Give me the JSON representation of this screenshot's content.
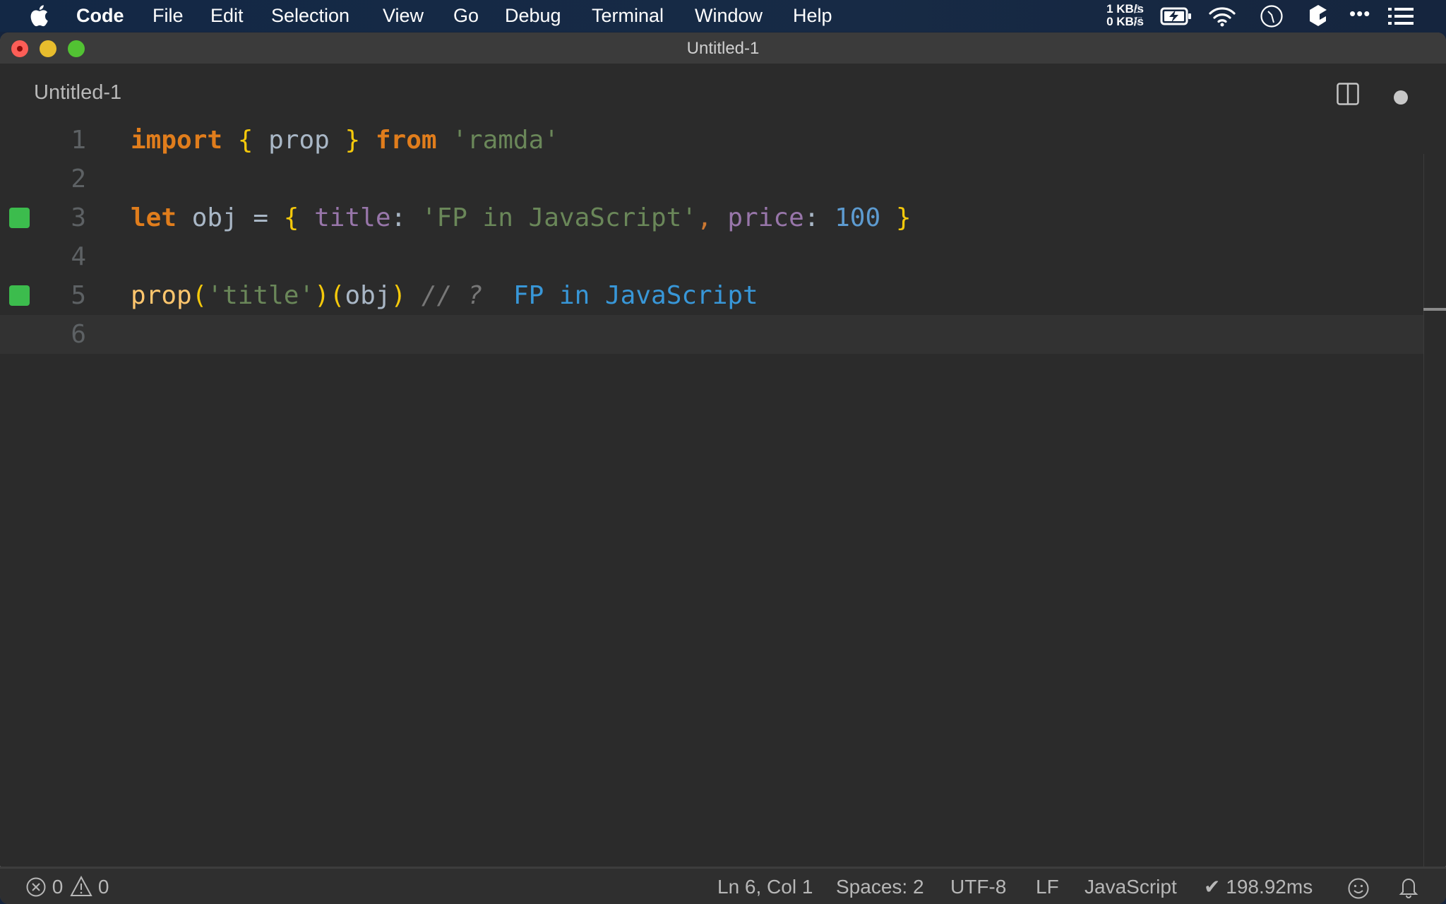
{
  "menubar": {
    "app_name": "Code",
    "menus": [
      "File",
      "Edit",
      "Selection",
      "View",
      "Go",
      "Debug",
      "Terminal",
      "Window",
      "Help"
    ],
    "net_up": "1 KB/s",
    "net_down": "0 KB/s",
    "tray_icons": [
      "upload-arrow-icon",
      "download-arrow-icon",
      "battery-charging-icon",
      "wifi-icon",
      "clock-icon",
      "dropbox-icon",
      "more-icon",
      "notification-center-icon"
    ]
  },
  "window": {
    "title": "Untitled-1"
  },
  "tab": {
    "label": "Untitled-1",
    "dirty": true
  },
  "editor": {
    "current_line": 6,
    "lines": [
      {
        "number": "1",
        "marker": false,
        "tokens": [
          {
            "t": "import",
            "c": "kw"
          },
          {
            "t": " ",
            "c": "id"
          },
          {
            "t": "{",
            "c": "brace"
          },
          {
            "t": " prop ",
            "c": "id"
          },
          {
            "t": "}",
            "c": "brace"
          },
          {
            "t": " ",
            "c": "id"
          },
          {
            "t": "from",
            "c": "kw"
          },
          {
            "t": " ",
            "c": "id"
          },
          {
            "t": "'ramda'",
            "c": "str"
          }
        ]
      },
      {
        "number": "2",
        "marker": false,
        "tokens": []
      },
      {
        "number": "3",
        "marker": true,
        "tokens": [
          {
            "t": "let",
            "c": "kw"
          },
          {
            "t": " obj = ",
            "c": "id"
          },
          {
            "t": "{",
            "c": "brace"
          },
          {
            "t": " ",
            "c": "id"
          },
          {
            "t": "title",
            "c": "prop"
          },
          {
            "t": ": ",
            "c": "punct"
          },
          {
            "t": "'FP in JavaScript'",
            "c": "str"
          },
          {
            "t": ",",
            "c": "comma"
          },
          {
            "t": " ",
            "c": "id"
          },
          {
            "t": "price",
            "c": "prop"
          },
          {
            "t": ": ",
            "c": "punct"
          },
          {
            "t": "100",
            "c": "num"
          },
          {
            "t": " ",
            "c": "id"
          },
          {
            "t": "}",
            "c": "brace"
          }
        ]
      },
      {
        "number": "4",
        "marker": false,
        "tokens": []
      },
      {
        "number": "5",
        "marker": true,
        "tokens": [
          {
            "t": "prop",
            "c": "fn"
          },
          {
            "t": "(",
            "c": "brace"
          },
          {
            "t": "'title'",
            "c": "str"
          },
          {
            "t": ")",
            "c": "brace"
          },
          {
            "t": "(",
            "c": "brace"
          },
          {
            "t": "obj",
            "c": "id"
          },
          {
            "t": ")",
            "c": "brace"
          },
          {
            "t": " ",
            "c": "id"
          },
          {
            "t": "// ?",
            "c": "comment"
          },
          {
            "t": "  ",
            "c": "id"
          },
          {
            "t": "FP in JavaScript",
            "c": "result"
          }
        ]
      },
      {
        "number": "6",
        "marker": false,
        "tokens": []
      }
    ]
  },
  "statusbar": {
    "errors": "0",
    "warnings": "0",
    "cursor": "Ln 6, Col 1",
    "indent": "Spaces: 2",
    "encoding": "UTF-8",
    "eol": "LF",
    "language": "JavaScript",
    "timing": "✔ 198.92ms"
  },
  "colors": {
    "marker_green": "#3cbc4d",
    "keyword": "#e07d1c",
    "string": "#6a8759",
    "brace": "#f5c90b",
    "property": "#9876aa",
    "number": "#5d9bd0",
    "result": "#3897d8"
  }
}
